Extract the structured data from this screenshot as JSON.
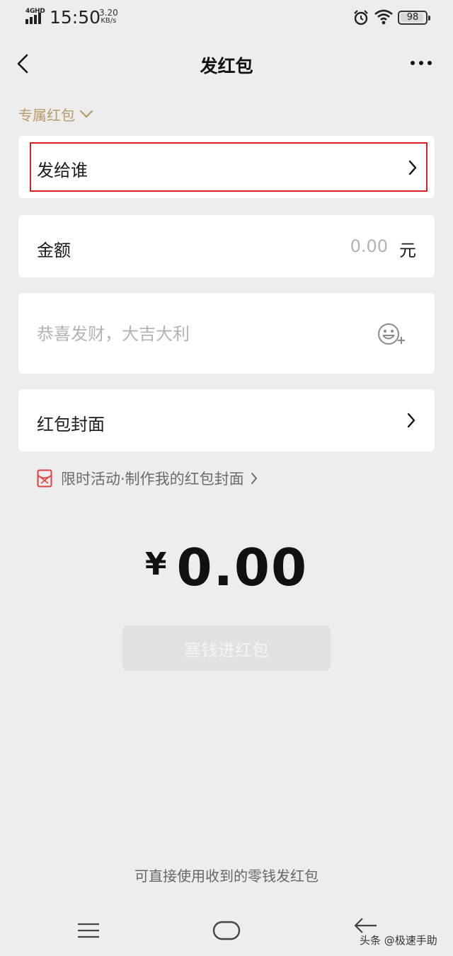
{
  "status_bar": {
    "network": "4GHD",
    "time": "15:50",
    "speed_value": "3.20",
    "speed_unit": "KB/s",
    "battery": "98",
    "icons": [
      "signal-icon",
      "alarm-icon",
      "wifi-icon",
      "battery-icon"
    ]
  },
  "header": {
    "title": "发红包",
    "back_icon": "back-chevron-icon",
    "more_icon": "more-dots-icon"
  },
  "packet_type": {
    "label": "专属红包",
    "icon": "chevron-down-icon"
  },
  "recipient": {
    "label": "发给谁",
    "icon": "chevron-right-icon"
  },
  "amount": {
    "label": "金额",
    "value": "0.00",
    "unit": "元"
  },
  "greeting": {
    "placeholder": "恭喜发财，大吉大利",
    "icon": "emoji-add-icon"
  },
  "cover": {
    "label": "红包封面",
    "icon": "chevron-right-icon"
  },
  "promo": {
    "text": "限时活动·制作我的红包封面",
    "icon": "red-packet-cover-icon"
  },
  "total": {
    "currency": "¥",
    "value": "0.00"
  },
  "submit": {
    "label": "塞钱进红包"
  },
  "tip": "可直接使用收到的零钱发红包",
  "watermark": "头条 @极速手助",
  "colors": {
    "background": "#ededed",
    "card": "#ffffff",
    "accent_gold": "#b89b6a",
    "highlight_red": "#e02020",
    "disabled_button": "#e1e1e1",
    "placeholder": "#b3b3b3"
  }
}
